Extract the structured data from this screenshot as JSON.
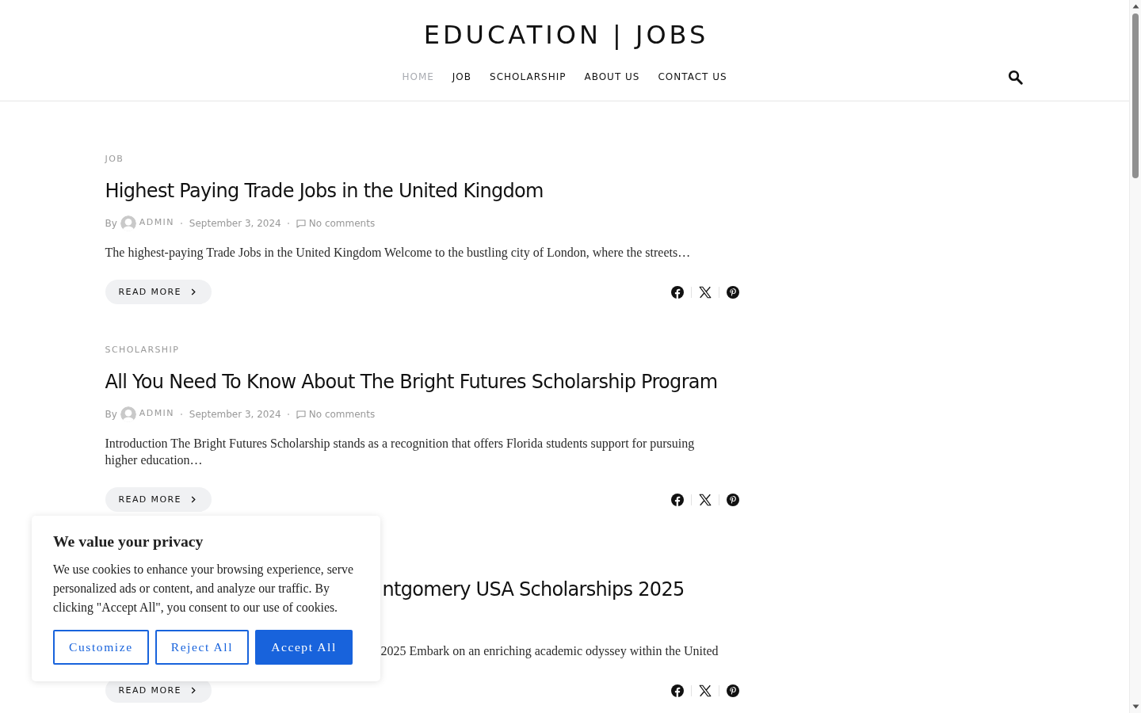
{
  "site_title": "EDUCATION | JOBS",
  "nav": [
    {
      "label": "HOME",
      "selected": true
    },
    {
      "label": "JOB",
      "selected": false
    },
    {
      "label": "SCHOLARSHIP",
      "selected": false
    },
    {
      "label": "ABOUT US",
      "selected": false
    },
    {
      "label": "CONTACT US",
      "selected": false
    }
  ],
  "posts": [
    {
      "category": "JOB",
      "title": "Highest Paying Trade Jobs in the United Kingdom",
      "meta": {
        "by": "By",
        "author": "ADMIN",
        "date": "September 3, 2024",
        "comments": "No comments"
      },
      "excerpt": "The highest-paying Trade Jobs in the United Kingdom Welcome to the bustling city of London, where the streets…",
      "button": "READ MORE"
    },
    {
      "category": "SCHOLARSHIP",
      "title": "All You Need To Know About The Bright Futures Scholarship Program",
      "meta": {
        "by": "By",
        "author": "ADMIN",
        "date": "September 3, 2024",
        "comments": "No comments"
      },
      "excerpt": "Introduction The Bright Futures Scholarship stands as a recognition that offers Florida students support for pursuing higher education…",
      "button": "READ MORE"
    },
    {
      "title": "ntgomery USA Scholarships 2025",
      "excerpt": "2025 Embark on an enriching academic odyssey within the United",
      "button": "READ MORE"
    }
  ],
  "cookie_banner": {
    "title": "We value your privacy",
    "text": "We use cookies to enhance your browsing experience, serve personalized ads or content, and analyze our traffic. By clicking \"Accept All\", you consent to our use of cookies.",
    "buttons": [
      {
        "label": "Customize",
        "kind": "outline"
      },
      {
        "label": "Reject All",
        "kind": "outline"
      },
      {
        "label": "Accept All",
        "kind": "filled"
      }
    ]
  }
}
